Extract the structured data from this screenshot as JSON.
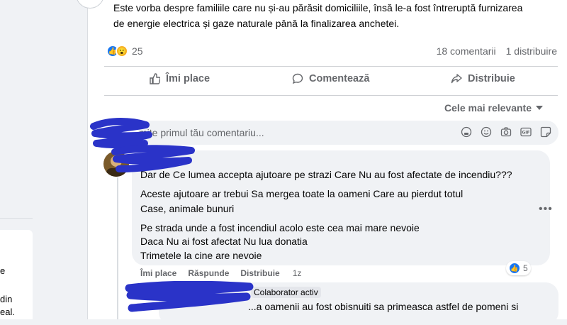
{
  "left": {
    "lines": [
      "e",
      "din",
      "eal."
    ]
  },
  "post": {
    "text_line1": "Este vorba despre familiile care nu și-au părăsit domiciliile, însă le-a fost întreruptă furnizarea",
    "text_line2": "de energie electrica și gaze naturale până la finalizarea  anchetei.",
    "reaction_count": "25",
    "comments_count": "18 comentarii",
    "shares_count": "1 distribuire"
  },
  "actions": {
    "like": "Îmi place",
    "comment": "Comentează",
    "share": "Distribuie"
  },
  "sort": {
    "label": "Cele mai relevante"
  },
  "comment_input": {
    "placeholder": "mite primul tău comentariu..."
  },
  "comment": {
    "line1": "Dar de Ce lumea accepta ajutoare pe strazi Care Nu au fost afectate de incendiu???",
    "line2": "Aceste ajutoare ar trebui Sa mergea toate la oameni Care au pierdut totul",
    "line3": "Case, animale bunuri",
    "line4": "Pe strada unde a fost incendiul acolo este cea mai mare nevoie",
    "line5": "Daca Nu ai fost afectat Nu lua donatia",
    "line6": "Trimetele la cine are nevoie",
    "like_label": "Îmi place",
    "reply_label": "Răspunde",
    "share_label": "Distribuie",
    "time": "1z",
    "reaction_count": "5"
  },
  "reply": {
    "badge": "Colaborator activ",
    "text": "...a oamenii au fost obisnuiti sa primeasca astfel de pomeni si"
  },
  "colors": {
    "accent": "#1877f2",
    "redaction": "#2a33c8"
  }
}
